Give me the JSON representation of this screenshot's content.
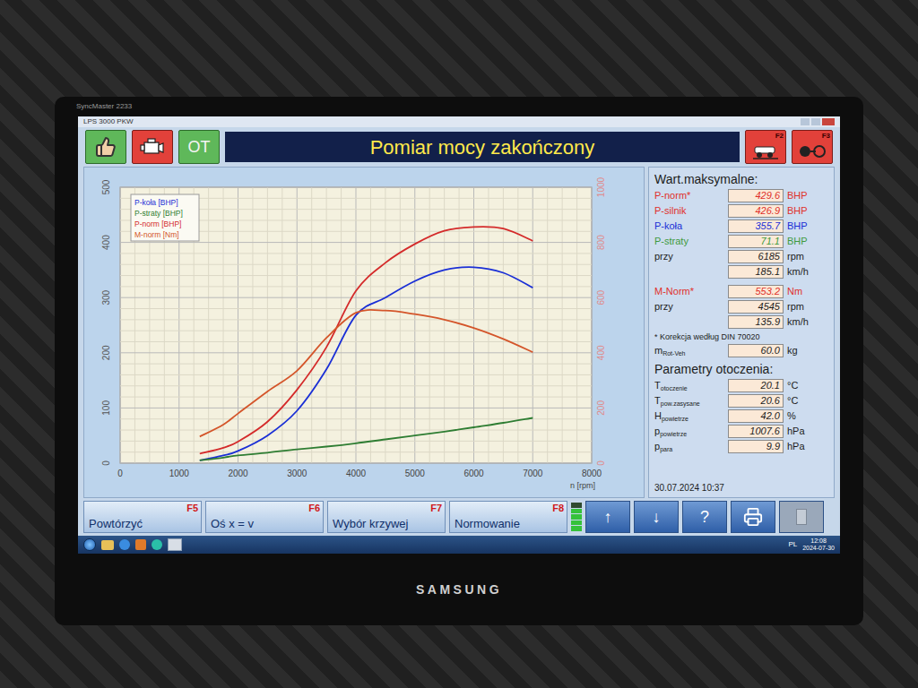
{
  "bezel": {
    "model": "SyncMaster 2233",
    "brand": "SAMSUNG"
  },
  "window": {
    "title": "LPS 3000 PKW"
  },
  "toolbar": {
    "ot_label": "OT",
    "title": "Pomiar mocy zakończony",
    "function_keys": [
      "F2",
      "F3"
    ]
  },
  "chart": {
    "y_ticks": [
      "0",
      "100",
      "200",
      "300",
      "400",
      "500"
    ],
    "y2_ticks": [
      "0",
      "200",
      "400",
      "600",
      "800",
      "1000"
    ],
    "x_ticks": [
      "0",
      "1000",
      "2000",
      "3000",
      "4000",
      "5000",
      "6000",
      "7000",
      "8000"
    ],
    "x_title": "n [rpm]",
    "rpm": [
      1350,
      1750,
      2000,
      2500,
      3000,
      3500,
      4000,
      4500,
      5000,
      5500,
      6000,
      6500,
      7000
    ],
    "series": [
      {
        "label": "P-koła [BHP]",
        "color": "#1a2fd6",
        "axis": "left",
        "values": [
          5,
          14,
          22,
          50,
          95,
          170,
          268,
          300,
          330,
          350,
          355,
          345,
          318
        ]
      },
      {
        "label": "P-straty [BHP]",
        "color": "#2e7d32",
        "axis": "left",
        "values": [
          5,
          10,
          14,
          19,
          25,
          30,
          36,
          43,
          50,
          57,
          65,
          73,
          82
        ]
      },
      {
        "label": "P-norm [BHP]",
        "color": "#d42a2a",
        "axis": "left",
        "values": [
          17,
          28,
          39,
          75,
          133,
          210,
          312,
          363,
          397,
          421,
          428,
          425,
          403
        ]
      },
      {
        "label": "M-norm [Nm]",
        "color": "#d4552a",
        "axis": "right",
        "values": [
          96,
          140,
          180,
          260,
          335,
          454,
          545,
          553,
          540,
          520,
          490,
          450,
          402
        ]
      }
    ]
  },
  "max_values": {
    "title": "Wart.maksymalne:",
    "power_rows": [
      {
        "label": "P-norm*",
        "value": "429.6",
        "unit": "BHP",
        "color": "#e0302a"
      },
      {
        "label": "P-silnik",
        "value": "426.9",
        "unit": "BHP",
        "color": "#e0302a"
      },
      {
        "label": "P-koła",
        "value": "355.7",
        "unit": "BHP",
        "color": "#1a2fd6"
      },
      {
        "label": "P-straty",
        "value": "71.1",
        "unit": "BHP",
        "color": "#3d9a3d"
      }
    ],
    "power_at": [
      {
        "label": "przy",
        "value": "6185",
        "unit": "rpm"
      },
      {
        "label": "",
        "value": "185.1",
        "unit": "km/h"
      }
    ],
    "torque_rows": [
      {
        "label": "M-Norm*",
        "value": "553.2",
        "unit": "Nm",
        "color": "#e0302a"
      }
    ],
    "torque_at": [
      {
        "label": "przy",
        "value": "4545",
        "unit": "rpm"
      },
      {
        "label": "",
        "value": "135.9",
        "unit": "km/h"
      }
    ],
    "note": "* Korekcja według DIN 70020",
    "mass": {
      "symbol": "m",
      "sub": "Rot-Veh",
      "value": "60.0",
      "unit": "kg"
    }
  },
  "ambient": {
    "title": "Parametry otoczenia:",
    "rows": [
      {
        "symbol": "T",
        "sub": "otoczenie",
        "value": "20.1",
        "unit": "°C"
      },
      {
        "symbol": "T",
        "sub": "pow.zasysane",
        "value": "20.6",
        "unit": "°C"
      },
      {
        "symbol": "H",
        "sub": "powietrze",
        "value": "42.0",
        "unit": "%"
      },
      {
        "symbol": "p",
        "sub": "powietrze",
        "value": "1007.6",
        "unit": "hPa"
      },
      {
        "symbol": "p",
        "sub": "para",
        "value": "9.9",
        "unit": "hPa"
      }
    ]
  },
  "date": "30.07.2024 10:37",
  "function_buttons": [
    {
      "label": "Powtórzyć",
      "key": "F5"
    },
    {
      "label": "Oś x = v",
      "key": "F6"
    },
    {
      "label": "Wybór krzywej",
      "key": "F7"
    },
    {
      "label": "Normowanie",
      "key": "F8"
    }
  ],
  "indicator": {
    "level": 0.8
  },
  "nav_buttons": [
    {
      "kind": "text",
      "label": "↑",
      "disabled": false
    },
    {
      "kind": "text",
      "label": "↓",
      "disabled": false
    },
    {
      "kind": "text",
      "label": "?",
      "disabled": false
    },
    {
      "kind": "print",
      "disabled": false
    },
    {
      "kind": "blank",
      "disabled": true
    }
  ],
  "taskbar": {
    "language": "PL",
    "time": "12:08",
    "date": "2024-07-30"
  }
}
